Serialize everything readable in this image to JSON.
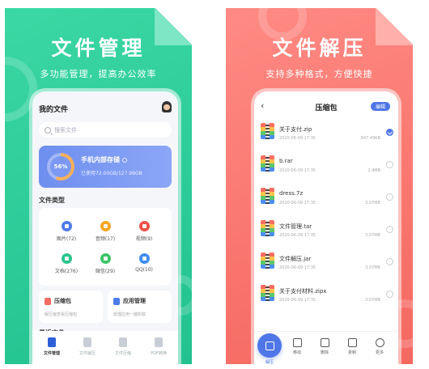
{
  "left_panel": {
    "headline": "文件管理",
    "subline": "多功能管理，提高办公效率",
    "header_title": "我的文件",
    "search_placeholder": "搜索文件",
    "storage": {
      "percent_label": "56%",
      "percent_value": 0.56,
      "title": "手机内部存储",
      "detail": "已使用72.00GB/127.99GB"
    },
    "types_title": "文件类型",
    "file_types": [
      {
        "label": "图片(72)",
        "icon": "image-icon",
        "color": "#4e7bea"
      },
      {
        "label": "音频(17)",
        "icon": "music-icon",
        "color": "#f5a623"
      },
      {
        "label": "视频(9)",
        "icon": "video-icon",
        "color": "#f0504a"
      },
      {
        "label": "文档(276)",
        "icon": "document-icon",
        "color": "#2bc48a"
      },
      {
        "label": "微信(29)",
        "icon": "wechat-icon",
        "color": "#3cc466"
      },
      {
        "label": "QQ(10)",
        "icon": "qq-icon",
        "color": "#3f8df0"
      }
    ],
    "tools": [
      {
        "title": "压缩包",
        "desc": "解压缩查看压缩包",
        "icon": "archive-icon",
        "color": "#f46b63"
      },
      {
        "title": "应用管理",
        "desc": "管理应用一键卸载",
        "icon": "apps-icon",
        "color": "#4e7bea"
      }
    ],
    "recent_title": "最近文件",
    "tabs": [
      {
        "label": "文件管理",
        "active": true
      },
      {
        "label": "文件解压",
        "active": false
      },
      {
        "label": "文件压缩",
        "active": false
      },
      {
        "label": "PDF转换",
        "active": false
      }
    ]
  },
  "right_panel": {
    "headline": "文件解压",
    "subline": "支持多种格式，方便快捷",
    "back_glyph": "‹",
    "title": "压缩包",
    "edit_label": "编辑",
    "files": [
      {
        "name": "关于支付.zip",
        "date": "2020-06-09 17:35",
        "size": "847.49KB",
        "checked": true
      },
      {
        "name": "b.rar",
        "date": "2020-06-09 17:35",
        "size": "2.4MB",
        "checked": false
      },
      {
        "name": "dress.7z",
        "date": "2020-06-09 17:35",
        "size": "3.07MB",
        "checked": false
      },
      {
        "name": "文件管理.tar",
        "date": "2020-06-09 17:35",
        "size": "3.07MB",
        "checked": false
      },
      {
        "name": "文件解压.jar",
        "date": "2020-06-09 17:35",
        "size": "3.07MB",
        "checked": false
      },
      {
        "name": "关于支付材料.zipx",
        "date": "2020-06-09 17:35",
        "size": "3.07MB",
        "checked": false
      }
    ],
    "actions": [
      {
        "label": "解压",
        "icon": "extract-icon",
        "active": true
      },
      {
        "label": "移动",
        "icon": "move-icon",
        "active": false
      },
      {
        "label": "删除",
        "icon": "delete-icon",
        "active": false
      },
      {
        "label": "复制",
        "icon": "copy-icon",
        "active": false
      },
      {
        "label": "更多",
        "icon": "more-icon",
        "active": false
      }
    ]
  }
}
